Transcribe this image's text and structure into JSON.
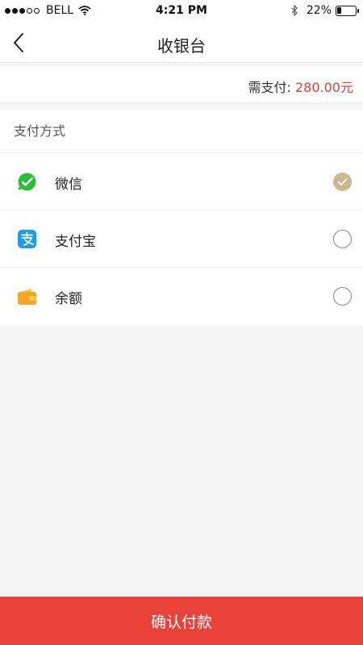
{
  "status_bar": {
    "carrier": "BELL",
    "time": "4:21 PM",
    "battery_percent": "22%",
    "battery_level": 0.22
  },
  "nav": {
    "title": "收银台",
    "back_icon": "chevron-left-icon"
  },
  "amount": {
    "label": "需支付:",
    "value": "280.00元",
    "value_color": "#e23b3b"
  },
  "payment": {
    "section_title": "支付方式",
    "options": [
      {
        "label": "微信",
        "icon": "wechat-icon",
        "icon_color": "#2bbd3b",
        "selected": true
      },
      {
        "label": "支付宝",
        "icon": "alipay-icon",
        "icon_color": "#1e9ce6",
        "selected": false
      },
      {
        "label": "余额",
        "icon": "wallet-icon",
        "icon_color": "#f5a623",
        "selected": false
      }
    ],
    "checked_color": "#c8b98e"
  },
  "footer": {
    "confirm_label": "确认付款",
    "button_color": "#e94339"
  }
}
